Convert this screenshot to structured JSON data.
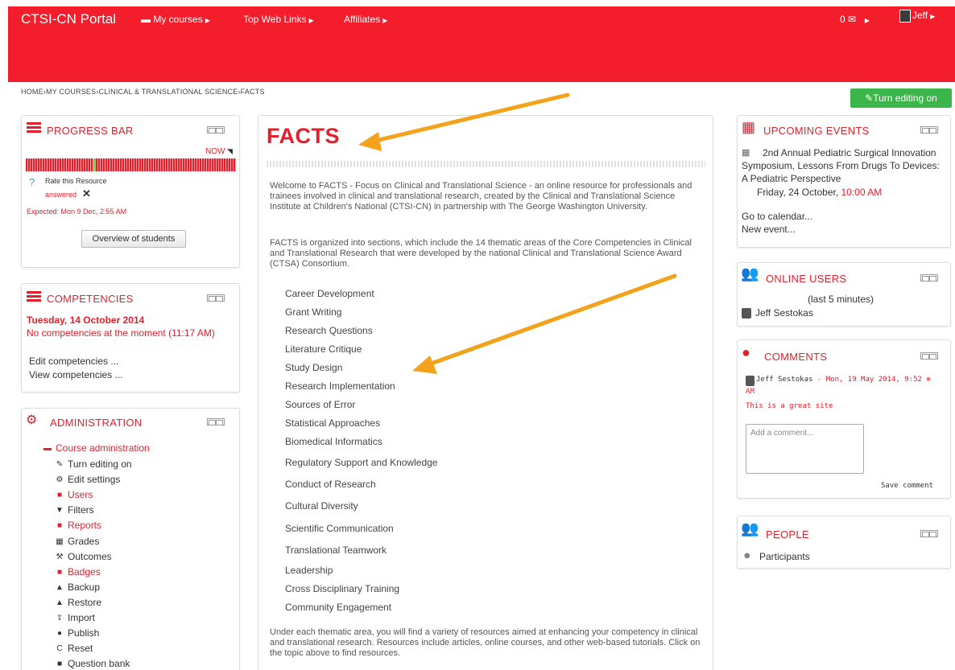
{
  "topbar": {
    "brand": "CTSI-CN Portal",
    "my_courses": "My courses",
    "top_web_links": "Top Web Links",
    "affiliates": "Affiliates",
    "messages": "0",
    "user": "Jeff",
    "bg_color": "#f31d2b"
  },
  "breadcrumb": "HOME›MY COURSES›CLINICAL & TRANSLATIONAL SCIENCE›FACTS",
  "edit_button": "Turn editing on",
  "progress": {
    "title": "PROGRESS BAR",
    "now": "NOW",
    "rate_label": "Rate this Resource",
    "answered": "answered",
    "expected": "Expected: Mon 9 Dec, 2:55 AM",
    "overview_button": "Overview of students"
  },
  "competencies": {
    "title": "COMPETENCIES",
    "date": "Tuesday, 14 October 2014",
    "message": "No competencies at the moment (11:17 AM)",
    "edit": "Edit competencies ...",
    "view": "View competencies ..."
  },
  "administration": {
    "title": "ADMINISTRATION",
    "course_admin": "Course administration",
    "items": [
      {
        "label": "Turn editing on",
        "icon": "pencil-icon",
        "glyph": "✎",
        "red": false
      },
      {
        "label": "Edit settings",
        "icon": "gear-icon",
        "glyph": "⚙",
        "red": false
      },
      {
        "label": "Users",
        "icon": "folder-icon",
        "glyph": "■",
        "red": true
      },
      {
        "label": "Filters",
        "icon": "filter-icon",
        "glyph": "▼",
        "red": false
      },
      {
        "label": "Reports",
        "icon": "folder-icon",
        "glyph": "■",
        "red": true
      },
      {
        "label": "Grades",
        "icon": "grid-icon",
        "glyph": "▦",
        "red": false
      },
      {
        "label": "Outcomes",
        "icon": "outcomes-icon",
        "glyph": "⚒",
        "red": false
      },
      {
        "label": "Badges",
        "icon": "folder-icon",
        "glyph": "■",
        "red": true
      },
      {
        "label": "Backup",
        "icon": "backup-icon",
        "glyph": "▲",
        "red": false
      },
      {
        "label": "Restore",
        "icon": "restore-icon",
        "glyph": "▲",
        "red": false
      },
      {
        "label": "Import",
        "icon": "import-icon",
        "glyph": "⇪",
        "red": false
      },
      {
        "label": "Publish",
        "icon": "publish-icon",
        "glyph": "●",
        "red": false
      },
      {
        "label": "Reset",
        "icon": "reset-icon",
        "glyph": "C",
        "red": false
      },
      {
        "label": "Question bank",
        "icon": "folder-icon",
        "glyph": "■",
        "red": false
      }
    ]
  },
  "main": {
    "title": "FACTS",
    "intro": "Welcome to FACTS - Focus on Clinical and Translational Science - an online resource for professionals and trainees involved in clinical and translational research, created by the Clinical and Translational Science Institute at Children's National (CTSI-CN) in partnership with The George Washington University.",
    "organized": "FACTS is organized into sections, which include the 14 thematic areas of the Core Competencies in Clinical and Translational Research that were developed by the national Clinical and Translational Science Award (CTSA) Consortium.",
    "topics": [
      "Career Development",
      "Grant Writing",
      "Research Questions",
      "Literature Critique",
      "Study Design",
      "Research Implementation",
      "Sources of Error",
      "Statistical Approaches",
      "Biomedical Informatics",
      "Regulatory Support and Knowledge",
      "Conduct of Research",
      "Cultural Diversity",
      "Scientific Communication",
      "Translational Teamwork",
      "Leadership",
      "Cross Disciplinary Training",
      "Community Engagement"
    ],
    "outro": "Under each thematic area, you will find a variety of resources aimed at enhancing your competency in clinical and translational research. Resources include articles, online courses, and other web-based tutorials. Click on the topic above to find resources."
  },
  "events": {
    "title": "UPCOMING EVENTS",
    "event_name": "2nd Annual Pediatric Surgical Innovation Symposium, Lessons From Drugs To Devices: A Pediatric Perspective",
    "event_date": "Friday, 24 October,",
    "event_time": "10:00 AM",
    "go_calendar": "Go to calendar...",
    "new_event": "New event..."
  },
  "online_users": {
    "title": "ONLINE USERS",
    "subtitle": "(last 5 minutes)",
    "user": "Jeff Sestokas"
  },
  "comments": {
    "title": "COMMENTS",
    "author": "Jeff Sestokas",
    "date": " - Mon, 19 May 2014, 9:52",
    "am": "AM",
    "text": "This is a great site",
    "placeholder": "Add a comment...",
    "save": "Save comment"
  },
  "people": {
    "title": "PEOPLE",
    "participants": "Participants"
  }
}
